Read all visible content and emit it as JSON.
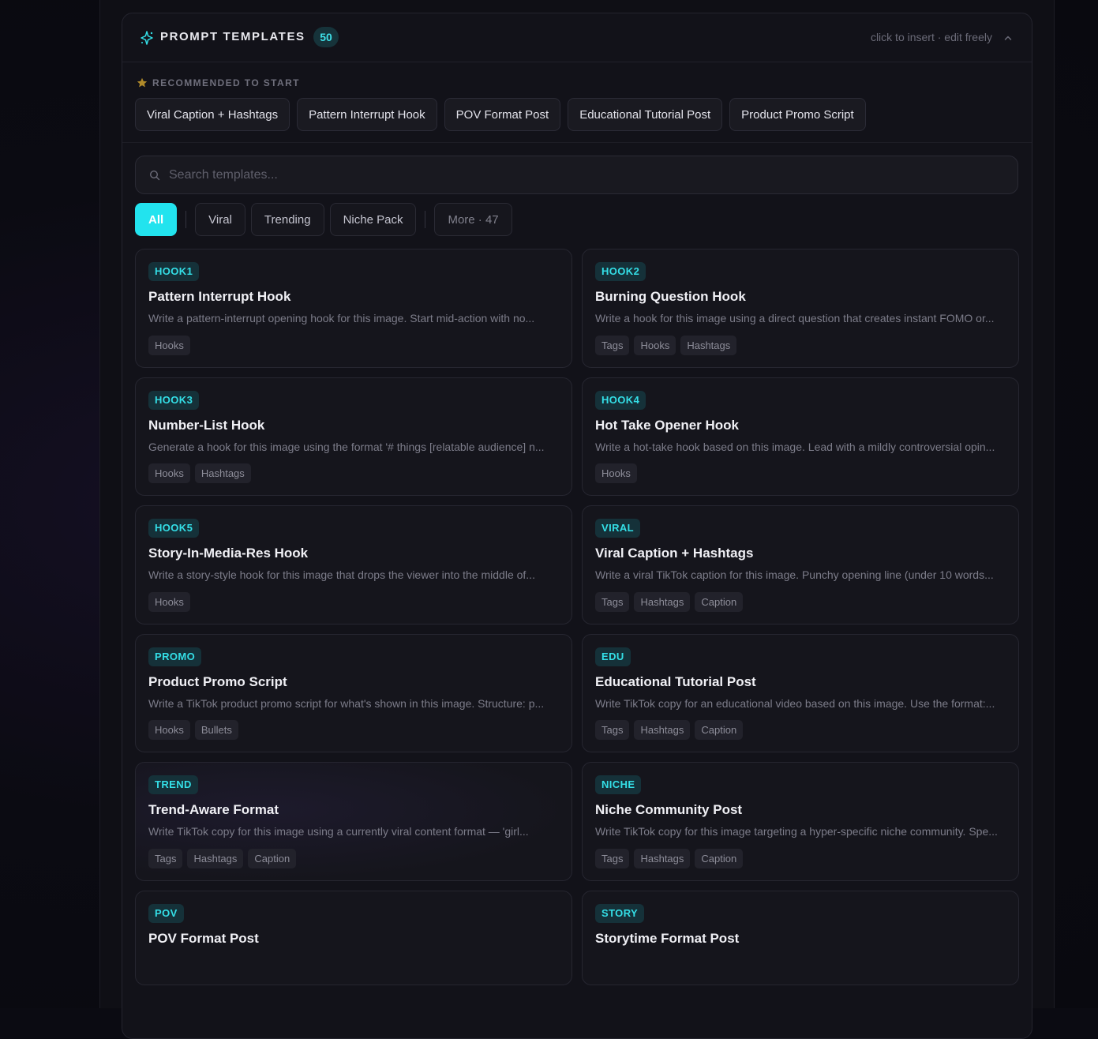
{
  "panel": {
    "title": "PROMPT TEMPLATES",
    "count": "50",
    "hint": "click to insert · edit freely"
  },
  "recommended": {
    "label": "RECOMMENDED TO START",
    "chips": [
      "Viral Caption + Hashtags",
      "Pattern Interrupt Hook",
      "POV Format Post",
      "Educational Tutorial Post",
      "Product Promo Script"
    ]
  },
  "search": {
    "placeholder": "Search templates..."
  },
  "filters": {
    "tabs": [
      "All",
      "Viral",
      "Trending",
      "Niche Pack"
    ],
    "more": "More · 47"
  },
  "cards": [
    {
      "id": "HOOK1",
      "title": "Pattern Interrupt Hook",
      "desc": "Write a pattern-interrupt opening hook for this image. Start mid-action with no...",
      "tags": [
        "Hooks"
      ]
    },
    {
      "id": "HOOK2",
      "title": "Burning Question Hook",
      "desc": "Write a hook for this image using a direct question that creates instant FOMO or...",
      "tags": [
        "Tags",
        "Hooks",
        "Hashtags"
      ]
    },
    {
      "id": "HOOK3",
      "title": "Number-List Hook",
      "desc": "Generate a hook for this image using the format '# things [relatable audience] n...",
      "tags": [
        "Hooks",
        "Hashtags"
      ]
    },
    {
      "id": "HOOK4",
      "title": "Hot Take Opener Hook",
      "desc": "Write a hot-take hook based on this image. Lead with a mildly controversial opin...",
      "tags": [
        "Hooks"
      ]
    },
    {
      "id": "HOOK5",
      "title": "Story-In-Media-Res Hook",
      "desc": "Write a story-style hook for this image that drops the viewer into the middle of...",
      "tags": [
        "Hooks"
      ]
    },
    {
      "id": "VIRAL",
      "title": "Viral Caption + Hashtags",
      "desc": "Write a viral TikTok caption for this image. Punchy opening line (under 10 words...",
      "tags": [
        "Tags",
        "Hashtags",
        "Caption"
      ]
    },
    {
      "id": "PROMO",
      "title": "Product Promo Script",
      "desc": "Write a TikTok product promo script for what's shown in this image. Structure: p...",
      "tags": [
        "Hooks",
        "Bullets"
      ]
    },
    {
      "id": "EDU",
      "title": "Educational Tutorial Post",
      "desc": "Write TikTok copy for an educational video based on this image. Use the format:...",
      "tags": [
        "Tags",
        "Hashtags",
        "Caption"
      ]
    },
    {
      "id": "TREND",
      "title": "Trend-Aware Format",
      "desc": "Write TikTok copy for this image using a currently viral content format — 'girl...",
      "tags": [
        "Tags",
        "Hashtags",
        "Caption"
      ]
    },
    {
      "id": "NICHE",
      "title": "Niche Community Post",
      "desc": "Write TikTok copy for this image targeting a hyper-specific niche community. Spe...",
      "tags": [
        "Tags",
        "Hashtags",
        "Caption"
      ]
    },
    {
      "id": "POV",
      "title": "POV Format Post",
      "desc": "",
      "tags": []
    },
    {
      "id": "STORY",
      "title": "Storytime Format Post",
      "desc": "",
      "tags": []
    }
  ]
}
